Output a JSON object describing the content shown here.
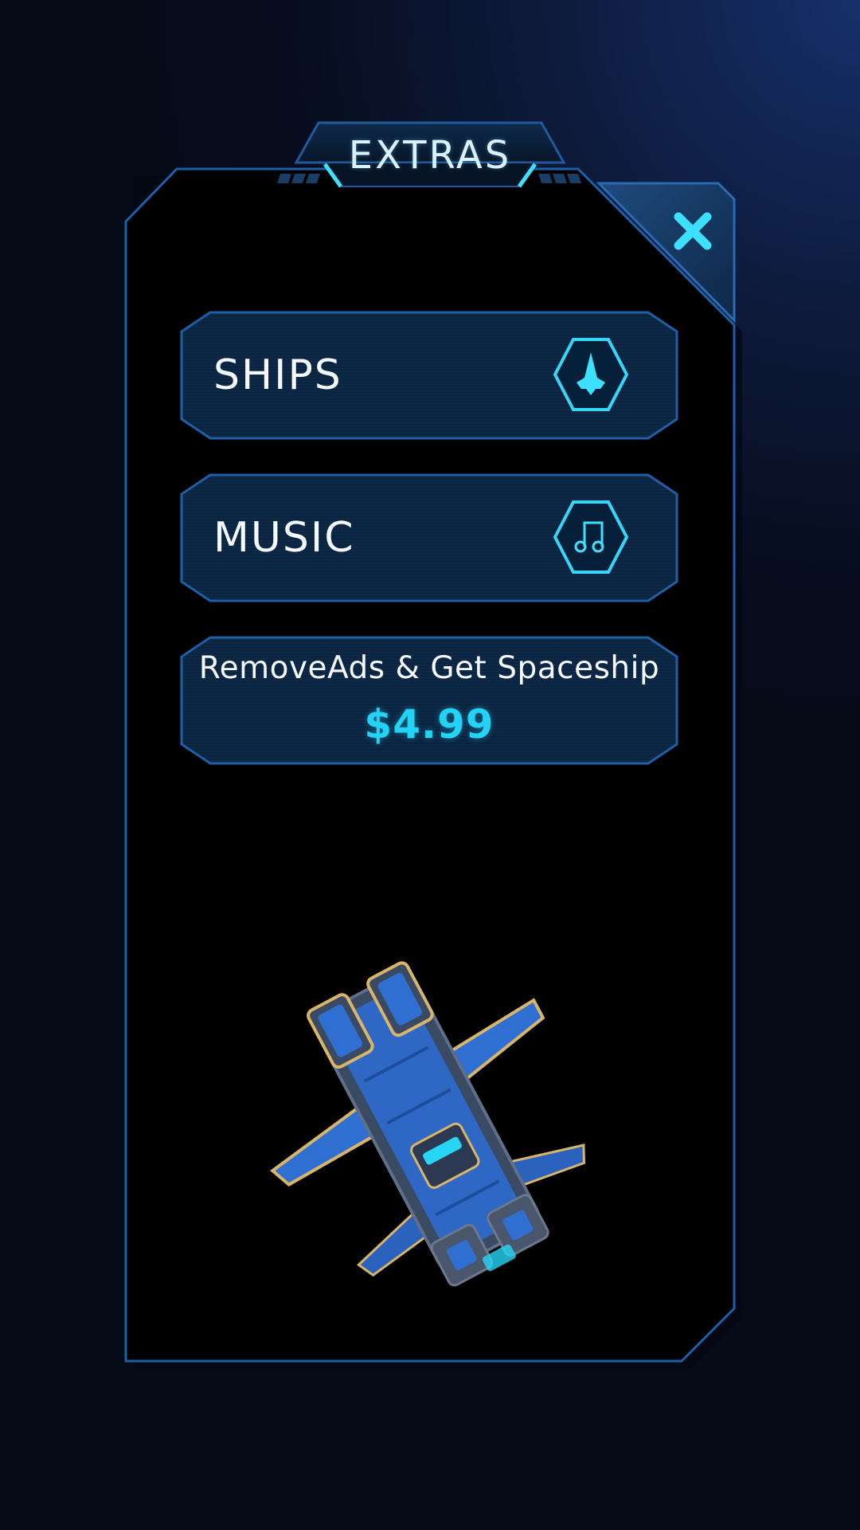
{
  "popup": {
    "title": "EXTRAS",
    "close_icon": "close-icon"
  },
  "buttons": [
    {
      "label": "SHIPS",
      "icon": "spaceship-icon"
    },
    {
      "label": "MUSIC",
      "icon": "music-note-icon"
    }
  ],
  "offer": {
    "title": "RemoveAds & Get Spaceship",
    "price": "$4.99"
  },
  "preview": {
    "icon": "spaceship-illustration"
  },
  "colors": {
    "accent": "#22d3f5",
    "panel_border": "#1d5fa8",
    "panel_fill": "#000000",
    "button_fill": "#0b2440",
    "text": "#f4f8ff"
  }
}
